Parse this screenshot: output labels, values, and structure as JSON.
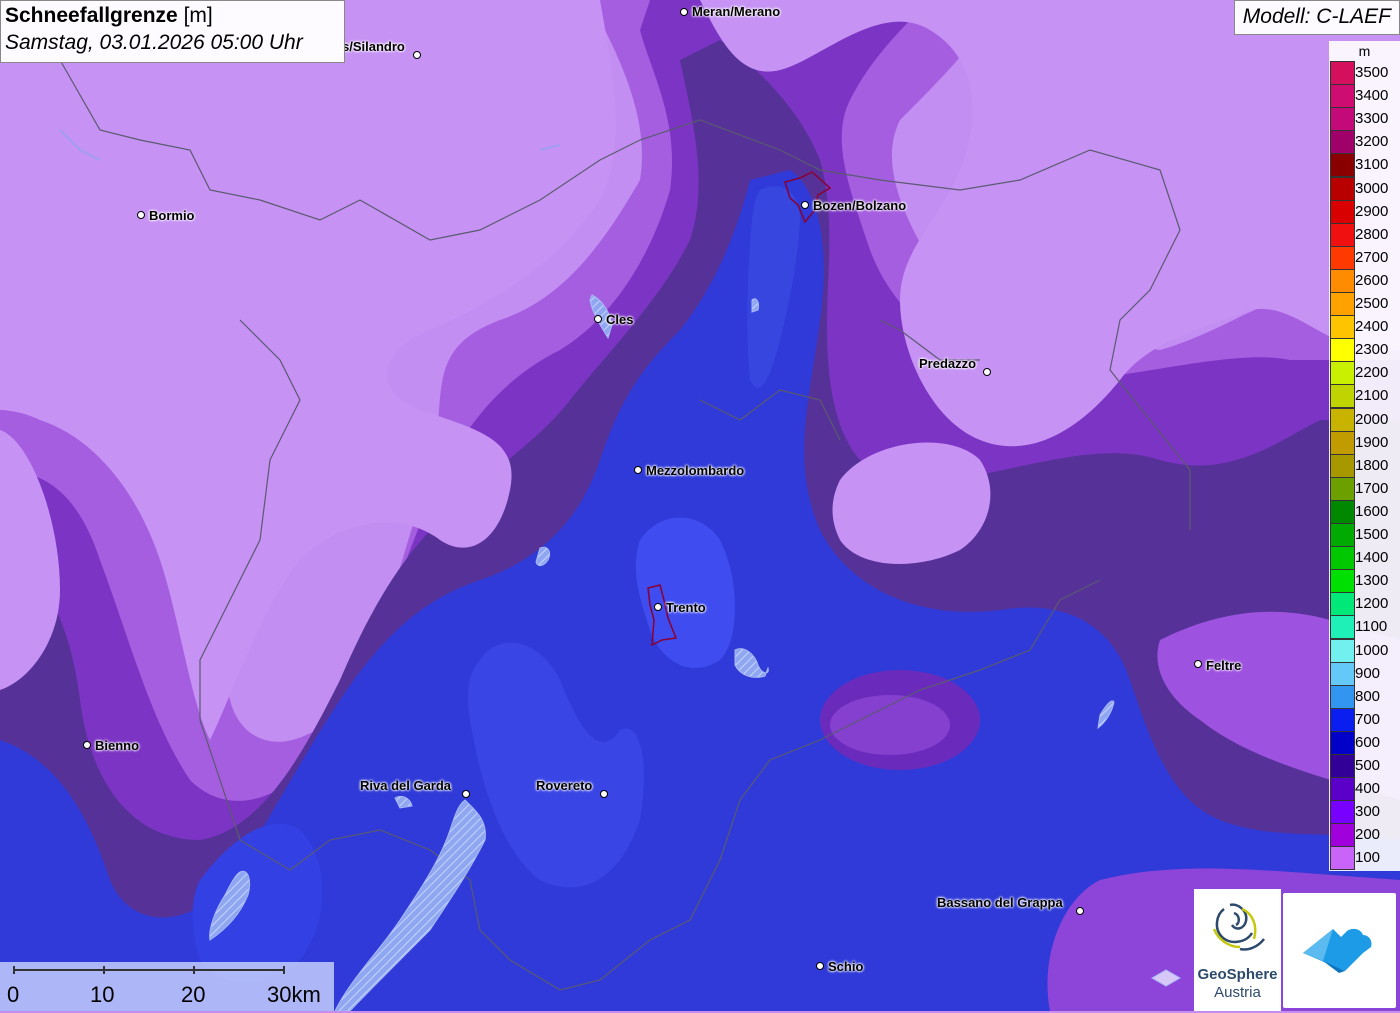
{
  "title": {
    "main_bold": "Schneefallgrenze",
    "unit": "[m]",
    "datetime": "Samstag, 03.01.2026 05:00 Uhr"
  },
  "model_label": "Modell: C-LAEF",
  "legend": {
    "unit": "m",
    "items": [
      {
        "label": "3500",
        "color": "#d4105e"
      },
      {
        "label": "3400",
        "color": "#cf0c6f"
      },
      {
        "label": "3300",
        "color": "#c40a78"
      },
      {
        "label": "3200",
        "color": "#a0006a"
      },
      {
        "label": "3100",
        "color": "#8a0000"
      },
      {
        "label": "3000",
        "color": "#b80000"
      },
      {
        "label": "2900",
        "color": "#d80000"
      },
      {
        "label": "2800",
        "color": "#f01010"
      },
      {
        "label": "2700",
        "color": "#ff3a00"
      },
      {
        "label": "2600",
        "color": "#ff8c00"
      },
      {
        "label": "2500",
        "color": "#ffa200"
      },
      {
        "label": "2400",
        "color": "#ffc400"
      },
      {
        "label": "2300",
        "color": "#ffff00"
      },
      {
        "label": "2200",
        "color": "#c8f000"
      },
      {
        "label": "2100",
        "color": "#c0d400"
      },
      {
        "label": "2000",
        "color": "#c8b400"
      },
      {
        "label": "1900",
        "color": "#c09c00"
      },
      {
        "label": "1800",
        "color": "#a89800"
      },
      {
        "label": "1700",
        "color": "#6ca000"
      },
      {
        "label": "1600",
        "color": "#008800"
      },
      {
        "label": "1500",
        "color": "#00aa00"
      },
      {
        "label": "1400",
        "color": "#00c800"
      },
      {
        "label": "1300",
        "color": "#00e000"
      },
      {
        "label": "1200",
        "color": "#00e878"
      },
      {
        "label": "1100",
        "color": "#1ef0b8"
      },
      {
        "label": "1000",
        "color": "#72f0f0"
      },
      {
        "label": "900",
        "color": "#64c8f8"
      },
      {
        "label": "800",
        "color": "#3296f0"
      },
      {
        "label": "700",
        "color": "#0a1ef0"
      },
      {
        "label": "600",
        "color": "#0000c8"
      },
      {
        "label": "500",
        "color": "#320096"
      },
      {
        "label": "400",
        "color": "#5a00c8"
      },
      {
        "label": "300",
        "color": "#7800ff"
      },
      {
        "label": "200",
        "color": "#a000dc"
      },
      {
        "label": "100",
        "color": "#c864f8"
      }
    ]
  },
  "places": [
    {
      "name": "Meran/Merano",
      "anchor": "right"
    },
    {
      "name": "s/Silandro",
      "anchor": "left"
    },
    {
      "name": "Bormio",
      "anchor": "right"
    },
    {
      "name": "Bozen/Bolzano",
      "anchor": "right"
    },
    {
      "name": "Cles",
      "anchor": "right"
    },
    {
      "name": "Predazzo",
      "anchor": "left"
    },
    {
      "name": "Mezzolombardo",
      "anchor": "right"
    },
    {
      "name": "Trento",
      "anchor": "right"
    },
    {
      "name": "Feltre",
      "anchor": "right"
    },
    {
      "name": "Bienno",
      "anchor": "right"
    },
    {
      "name": "Riva del Garda",
      "anchor": "left"
    },
    {
      "name": "Rovereto",
      "anchor": "left"
    },
    {
      "name": "Bassano del Grappa",
      "anchor": "left"
    },
    {
      "name": "Schio",
      "anchor": "right"
    }
  ],
  "scale": {
    "labels": [
      "0",
      "10",
      "20",
      "30km"
    ]
  },
  "logos": {
    "geosphere_name": "GeoSphere",
    "geosphere_sub": "Austria"
  }
}
